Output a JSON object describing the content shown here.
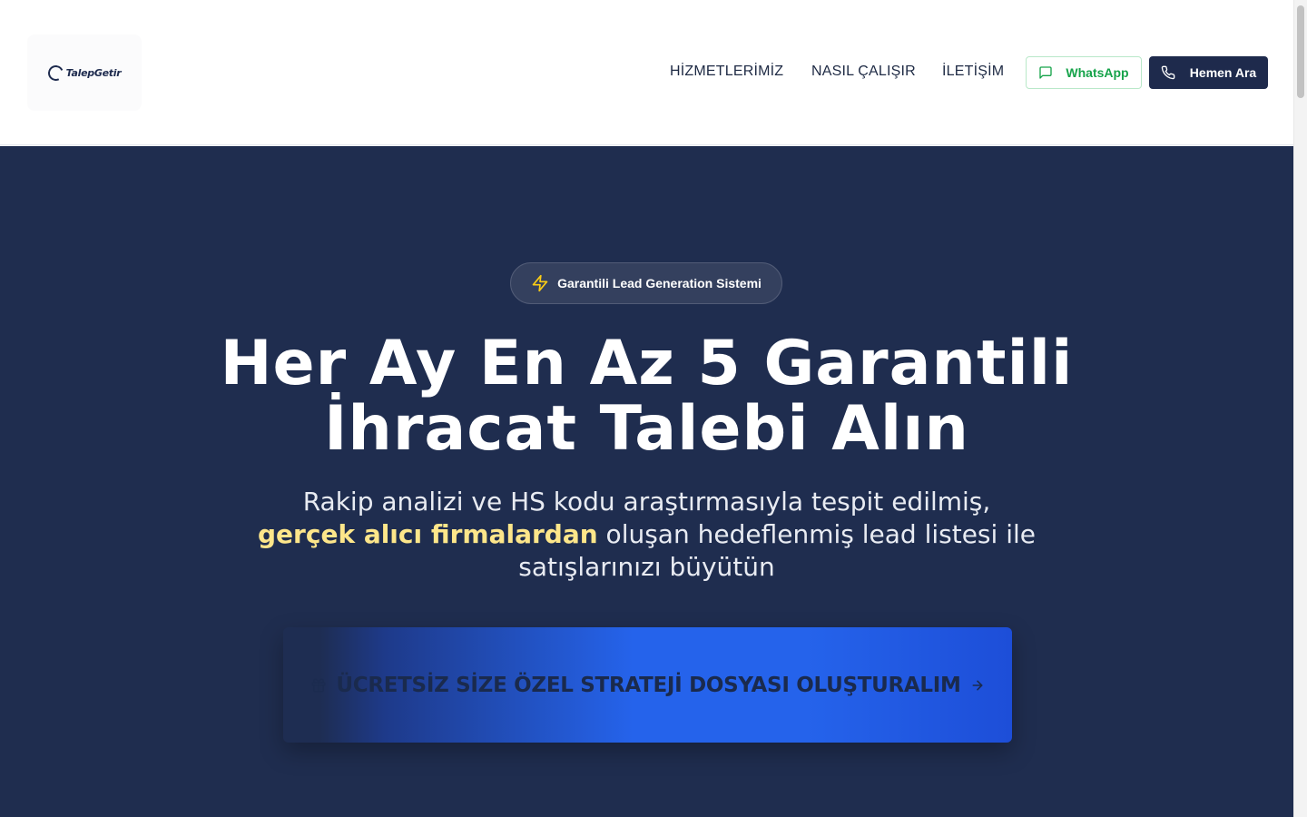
{
  "header": {
    "logo_text": "TalepGetir",
    "nav": [
      {
        "label": "HİZMETLERİMİZ"
      },
      {
        "label": "NASIL ÇALIŞIR"
      },
      {
        "label": "İLETİŞİM"
      }
    ],
    "whatsapp_label": "WhatsApp",
    "call_label": "Hemen Ara"
  },
  "hero": {
    "badge": "Garantili Lead Generation Sistemi",
    "title_line1": "Her Ay En Az 5 Garantili",
    "title_line2": "İhracat Talebi Alın",
    "sub_part1": "Rakip analizi ve HS kodu araştırmasıyla tespit edilmiş,",
    "sub_highlight": "gerçek alıcı firmalardan",
    "sub_part2": " oluşan hedeflenmiş lead listesi ile",
    "sub_part3": "satışlarınızı büyütün",
    "cta_label": "ÜCRETSİZ SİZE ÖZEL STRATEJİ DOSYASI OLUŞTURALIM"
  },
  "colors": {
    "hero_bg": "#1f2d4f",
    "accent_green": "#16a34a",
    "highlight_yellow": "#fde68a",
    "cta_blue": "#2563eb",
    "navy": "#1e2a4c"
  },
  "icons": {
    "badge": "lightning-icon",
    "whatsapp": "chat-bubble-icon",
    "call": "phone-icon",
    "cta_left": "gift-icon",
    "cta_right": "arrow-right-icon"
  }
}
